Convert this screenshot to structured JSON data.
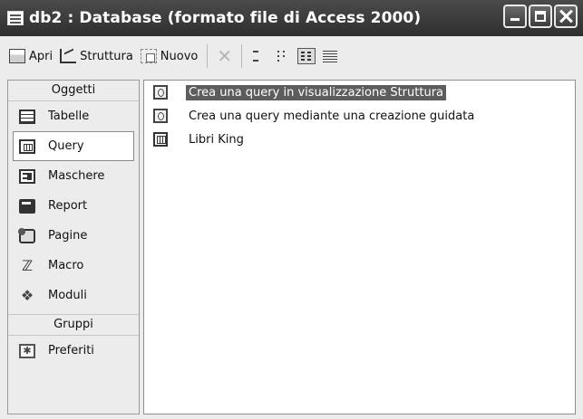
{
  "window": {
    "title": "db2 : Database (formato file di Access 2000)"
  },
  "toolbar": {
    "open_label": "Apri",
    "design_label": "Struttura",
    "new_label": "Nuovo"
  },
  "objects_bar": {
    "objects_header": "Oggetti",
    "items": [
      {
        "label": "Tabelle",
        "icon": "table-icon"
      },
      {
        "label": "Query",
        "icon": "query-icon",
        "selected": true
      },
      {
        "label": "Maschere",
        "icon": "form-icon"
      },
      {
        "label": "Report",
        "icon": "report-icon"
      },
      {
        "label": "Pagine",
        "icon": "page-icon"
      },
      {
        "label": "Macro",
        "icon": "macro-icon"
      },
      {
        "label": "Moduli",
        "icon": "module-icon"
      }
    ],
    "groups_header": "Gruppi",
    "groups": [
      {
        "label": "Preferiti",
        "icon": "favorites-icon"
      }
    ]
  },
  "list": {
    "items": [
      {
        "label": "Crea una query in visualizzazione Struttura",
        "icon": "design-wizard-icon",
        "selected": true
      },
      {
        "label": "Crea una query mediante una creazione guidata",
        "icon": "query-wizard-icon"
      },
      {
        "label": "Libri King",
        "icon": "query-icon"
      }
    ]
  },
  "colors": {
    "titlebar": "#3a3a3a",
    "selection": "#5d5d5d",
    "background": "#ececec"
  }
}
